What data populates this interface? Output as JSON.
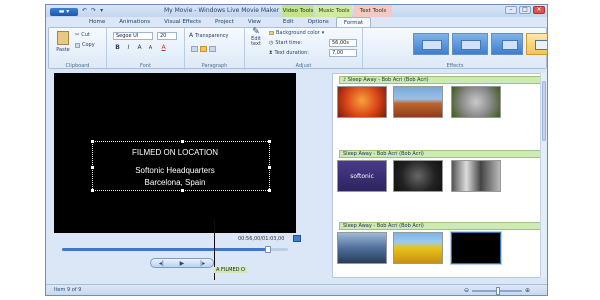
{
  "window": {
    "title": "My Movie - Windows Live Movie Maker",
    "app_button": "▬ ▾",
    "quick_access": [
      "↶",
      "↷",
      "▾"
    ],
    "controls": [
      "–",
      "□",
      "✕"
    ]
  },
  "context_groups": {
    "video": "Video Tools",
    "music": "Music Tools",
    "text": "Text Tools"
  },
  "tabs": [
    "Home",
    "Animations",
    "Visual Effects",
    "Project",
    "View",
    "Edit",
    "Options",
    "Format"
  ],
  "ribbon": {
    "clipboard": {
      "paste": "Paste",
      "cut": "Cut",
      "copy": "Copy",
      "label": "Clipboard"
    },
    "font": {
      "family": "Segoe UI",
      "size": "20",
      "bold": "B",
      "italic": "I",
      "grow": "A",
      "shrink": "A",
      "color": "A",
      "label": "Font"
    },
    "paragraph": {
      "transparency": "Transparency",
      "label": "Paragraph"
    },
    "adjust": {
      "edit_text": "Edit text",
      "background_color": "Background color",
      "start_time_label": "Start time:",
      "start_time_value": "56,00s",
      "text_duration_label": "Text duration:",
      "text_duration_value": "7,00",
      "label": "Adjust"
    },
    "effects": {
      "label": "Effects"
    }
  },
  "preview": {
    "caption_line1": "FILMED ON LOCATION",
    "caption_line2": "Softonic Headquarters",
    "caption_line3": "Barcelona, Spain",
    "timecode": "00:56,00/01:03,00",
    "seek_progress": 0.91,
    "prev": "◂|",
    "play": "▶",
    "next": "|▸"
  },
  "storyboard": {
    "audio_tracks": [
      "♪ Sleep Away - Bob Acri (Bob Acri)",
      "Sleep Away - Bob Acri (Bob Acri)",
      "Sleep Away - Bob Acri (Bob Acri)"
    ],
    "caption_tag": "A FILMED O",
    "softonic_logo": "softonic"
  },
  "status": {
    "item_count": "Item 9 of 9",
    "zoom_out": "⊖",
    "zoom_in": "⊕"
  },
  "colors": {
    "ribbon_bg": "#dde9f7",
    "audio_track": "#cde9b6",
    "selected_effect": "#f4c35a"
  }
}
